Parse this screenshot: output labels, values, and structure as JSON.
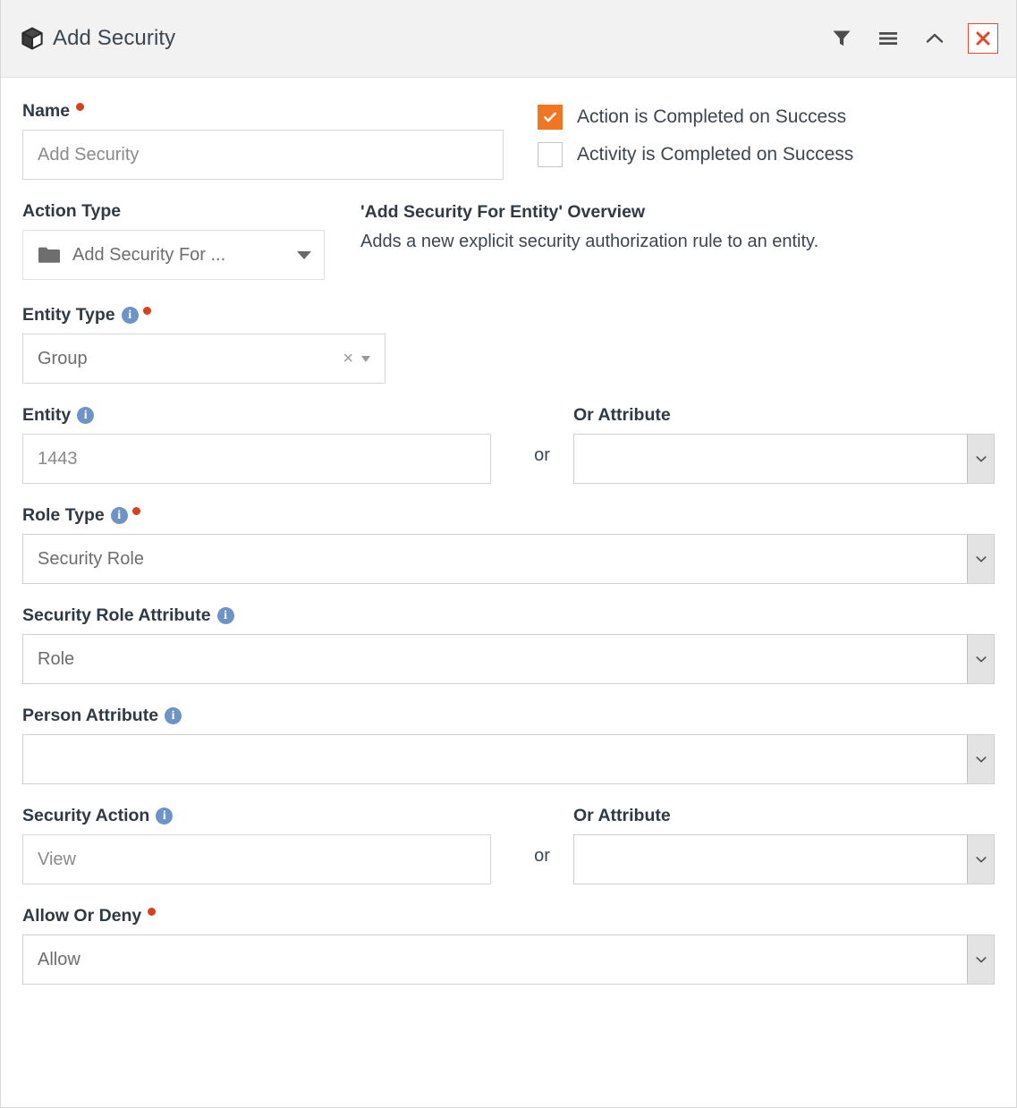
{
  "window": {
    "title": "Add Security",
    "title_icon": "cube-icon",
    "toolbar": [
      {
        "name": "filter-icon",
        "label": "Filter"
      },
      {
        "name": "menu-icon",
        "label": "Menu"
      },
      {
        "name": "collapse-icon",
        "label": "Collapse"
      },
      {
        "name": "close-icon",
        "label": "Close"
      }
    ]
  },
  "colors": {
    "accent_orange": "#ef7622",
    "required_red": "#d8401f",
    "close_red": "#e04a2f",
    "info_blue": "#6d94c4",
    "header_bg": "#f2f2f2",
    "text": "#3c4650"
  },
  "form": {
    "name": {
      "label": "Name",
      "required": true,
      "value": "",
      "placeholder": "Add Security"
    },
    "checkboxes": [
      {
        "label": "Action is Completed on Success",
        "checked": true
      },
      {
        "label": "Activity is Completed on Success",
        "checked": false
      }
    ],
    "action_type": {
      "label": "Action Type",
      "value": "Add Security For ...",
      "icon": "folder-icon"
    },
    "overview": {
      "title": "'Add Security For Entity' Overview",
      "text": "Adds a new explicit security authorization rule to an entity."
    },
    "entity_type": {
      "label": "Entity Type",
      "info": true,
      "required": true,
      "value": "Group",
      "clear_label": "×"
    },
    "entity": {
      "label": "Entity",
      "info": true,
      "required": false,
      "value": "",
      "placeholder": "1443"
    },
    "entity_or_attribute": {
      "label": "Or Attribute",
      "value": ""
    },
    "or_word": "or",
    "role_type": {
      "label": "Role Type",
      "info": true,
      "required": true,
      "value": "Security Role"
    },
    "security_role_attribute": {
      "label": "Security Role Attribute",
      "info": true,
      "required": false,
      "value": "Role"
    },
    "person_attribute": {
      "label": "Person Attribute",
      "info": true,
      "required": false,
      "value": ""
    },
    "security_action": {
      "label": "Security Action",
      "info": true,
      "required": false,
      "value": "",
      "placeholder": "View"
    },
    "security_action_or_attribute": {
      "label": "Or Attribute",
      "value": ""
    },
    "allow_or_deny": {
      "label": "Allow Or Deny",
      "required": true,
      "value": "Allow"
    }
  }
}
